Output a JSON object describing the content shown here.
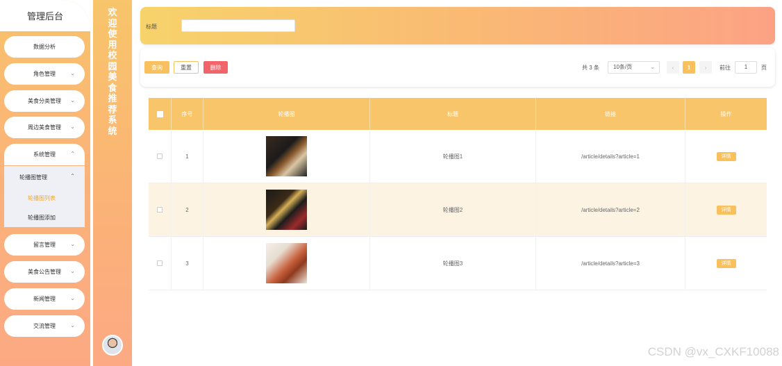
{
  "sidebar": {
    "title": "管理后台",
    "items": [
      {
        "label": "数据分析"
      },
      {
        "label": "角色管理"
      },
      {
        "label": "美食分类管理"
      },
      {
        "label": "周边美食管理"
      },
      {
        "label": "系统管理"
      },
      {
        "label": "留言管理"
      },
      {
        "label": "美食公告管理"
      },
      {
        "label": "新闻管理"
      },
      {
        "label": "交流管理"
      }
    ],
    "submenu": {
      "title": "轮播图管理",
      "links": [
        {
          "label": "轮播图列表",
          "active": true
        },
        {
          "label": "轮播图添加",
          "active": false
        }
      ]
    }
  },
  "welcome": {
    "text": "欢迎使用校园美食推荐系统"
  },
  "search": {
    "label": "标题",
    "value": ""
  },
  "toolbar": {
    "query": "查询",
    "reset": "重置",
    "delete": "删除"
  },
  "pager": {
    "total": "共 3 条",
    "page_size": "10条/页",
    "current_page": "1",
    "goto_label": "前往",
    "goto_value": "1",
    "goto_unit": "页"
  },
  "table": {
    "headers": [
      "序号",
      "轮播图",
      "标题",
      "链接",
      "操作"
    ],
    "rows": [
      {
        "no": "1",
        "title": "轮播图1",
        "link": "/article/details?article=1",
        "action": "详情"
      },
      {
        "no": "2",
        "title": "轮播图2",
        "link": "/article/details?article=2",
        "action": "详情"
      },
      {
        "no": "3",
        "title": "轮播图3",
        "link": "/article/details?article=3",
        "action": "详情"
      }
    ]
  },
  "watermark": "CSDN @vx_CXKF10088"
}
